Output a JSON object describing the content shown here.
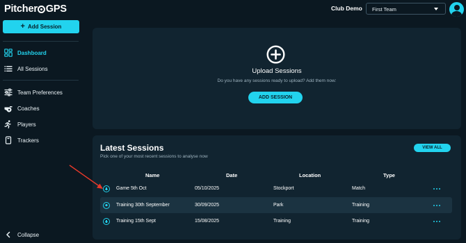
{
  "header": {
    "logo_left": "Pitcher",
    "logo_right": "GPS",
    "club_name": "Club Demo",
    "team_select": {
      "selected": "First Team"
    },
    "avatar_icon": "user-circle-icon"
  },
  "sidebar": {
    "add_session_label": "Add Session",
    "items": [
      {
        "label": "Dashboard",
        "icon": "grid-icon",
        "active": true
      },
      {
        "label": "All Sessions",
        "icon": "list-icon",
        "active": false
      },
      {
        "label": "Team Preferences",
        "icon": "sliders-icon",
        "active": false
      },
      {
        "label": "Coaches",
        "icon": "whistle-icon",
        "active": false
      },
      {
        "label": "Players",
        "icon": "running-person-icon",
        "active": false
      },
      {
        "label": "Trackers",
        "icon": "tracker-device-icon",
        "active": false
      }
    ],
    "collapse_label": "Collapse"
  },
  "upload": {
    "title": "Upload Sessions",
    "subtitle": "Do you have any sessions ready to upload? Add them now:",
    "button_label": "ADD SESSION"
  },
  "latest": {
    "title": "Latest Sessions",
    "subtitle": "Pick one of your most recent sessions to analyse now",
    "view_all_label": "VIEW ALL",
    "columns": [
      "Name",
      "Date",
      "Location",
      "Type"
    ],
    "rows": [
      {
        "name": "Game 5th Oct",
        "date": "05/10/2025",
        "location": "Stockport",
        "type": "Match"
      },
      {
        "name": "Training 30th September",
        "date": "30/09/2025",
        "location": "Park",
        "type": "Training"
      },
      {
        "name": "Training 15th Sept",
        "date": "15/08/2025",
        "location": "Training",
        "type": "Training"
      }
    ]
  },
  "colors": {
    "accent": "#22d3ee",
    "background": "#0b1821",
    "panel": "#112430",
    "annotation": "#e8392a"
  }
}
